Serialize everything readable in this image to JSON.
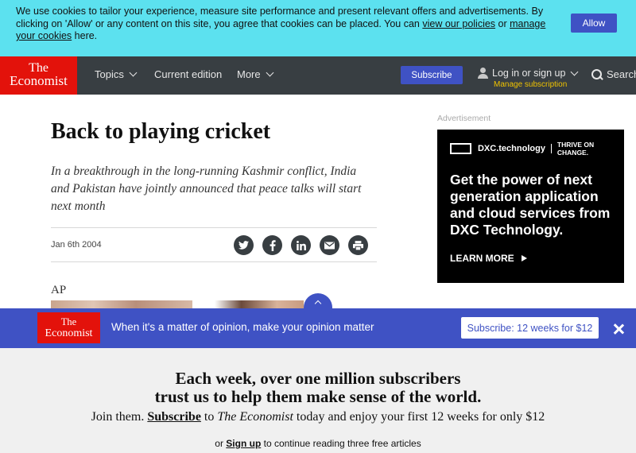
{
  "cookie_bar": {
    "text_before": "We use cookies to tailor your experience, measure site performance and present relevant offers and advertisements. By clicking on 'Allow' or any content on this site, you agree that cookies can be placed. You can ",
    "policies_link": "view our policies",
    "text_or": " or ",
    "manage_link": "manage your cookies",
    "text_after": " here.",
    "allow_label": "Allow"
  },
  "header": {
    "logo_line1": "The",
    "logo_line2": "Economist",
    "nav": [
      "Topics",
      "Current edition",
      "More"
    ],
    "subscribe_label": "Subscribe",
    "login_label": "Log in or sign up",
    "manage_label": "Manage subscription",
    "search_label": "Search"
  },
  "article": {
    "title": "Back to playing cricket",
    "subtitle": "In a breakthrough in the long-running Kashmir conflict, India and Pakistan have jointly announced that peace talks will start next month",
    "date": "Jan 6th 2004",
    "share_icons": [
      "twitter-icon",
      "facebook-icon",
      "linkedin-icon",
      "email-icon",
      "print-icon"
    ],
    "photo_credit": "AP"
  },
  "advert": {
    "label": "Advertisement",
    "brand": "DXC.technology",
    "tagline": "THRIVE ON CHANGE.",
    "headline": "Get the power of next generation application and cloud services from DXC Technology.",
    "cta": "LEARN MORE"
  },
  "promo": {
    "logo_line1": "The",
    "logo_line2": "Economist",
    "text": "When it's a matter of opinion, make your opinion matter",
    "button_label": "Subscribe: 12 weeks for $12"
  },
  "paywall": {
    "headline_line1": "Each week, over one million subscribers",
    "headline_line2": "trust us to help them make sense of the world.",
    "sub_before": "Join them. ",
    "sub_link": "Subscribe",
    "sub_to": " to ",
    "sub_brand": "The Economist",
    "sub_after": " today and enjoy your first 12 weeks for only $12",
    "note_or": "or ",
    "note_link": "Sign up",
    "note_after": " to continue reading three free articles"
  },
  "colors": {
    "cookie_bg": "#5ce1ef",
    "header_bg": "#383e42",
    "brand_red": "#e3120b",
    "accent_blue": "#3f52c4",
    "manage_yellow": "#f0c300"
  }
}
